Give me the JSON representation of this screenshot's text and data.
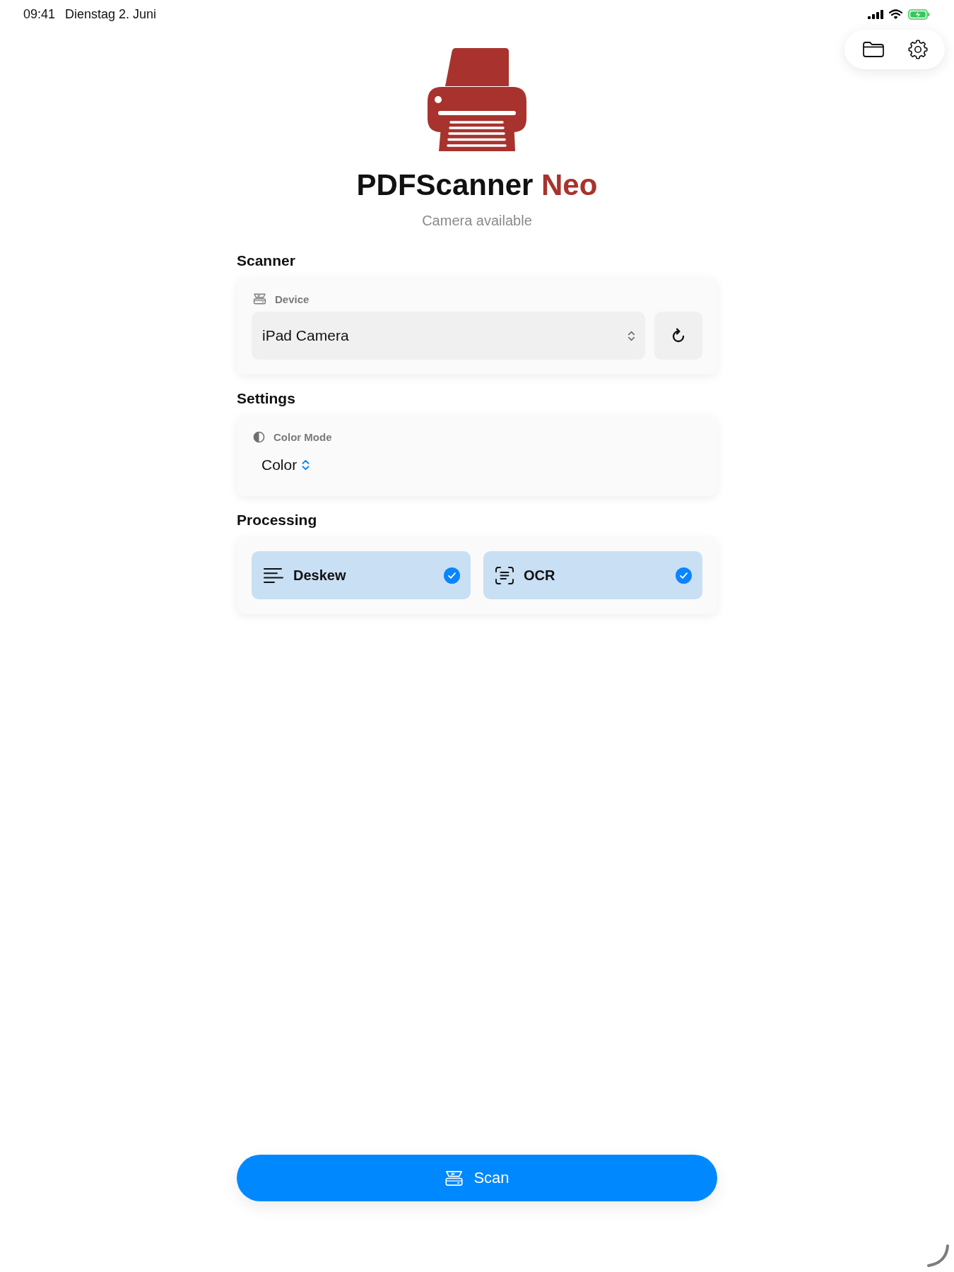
{
  "status_bar": {
    "time": "09:41",
    "date": "Dienstag 2. Juni"
  },
  "header": {
    "title": "PDFScanner",
    "title_accent": "Neo",
    "subtitle": "Camera available"
  },
  "sections": [
    {
      "kind": "picker",
      "heading": "Scanner",
      "label": "Device",
      "value": "iPad Camera"
    },
    {
      "kind": "menu",
      "heading": "Settings",
      "label": "Color Mode",
      "value": "Color"
    },
    {
      "kind": "toggles",
      "heading": "Processing",
      "toggles": [
        {
          "kind": "deskew",
          "label": "Deskew",
          "checked": true
        },
        {
          "kind": "ocr",
          "label": "OCR",
          "checked": true
        }
      ]
    }
  ],
  "scan_button": {
    "label": "Scan"
  }
}
